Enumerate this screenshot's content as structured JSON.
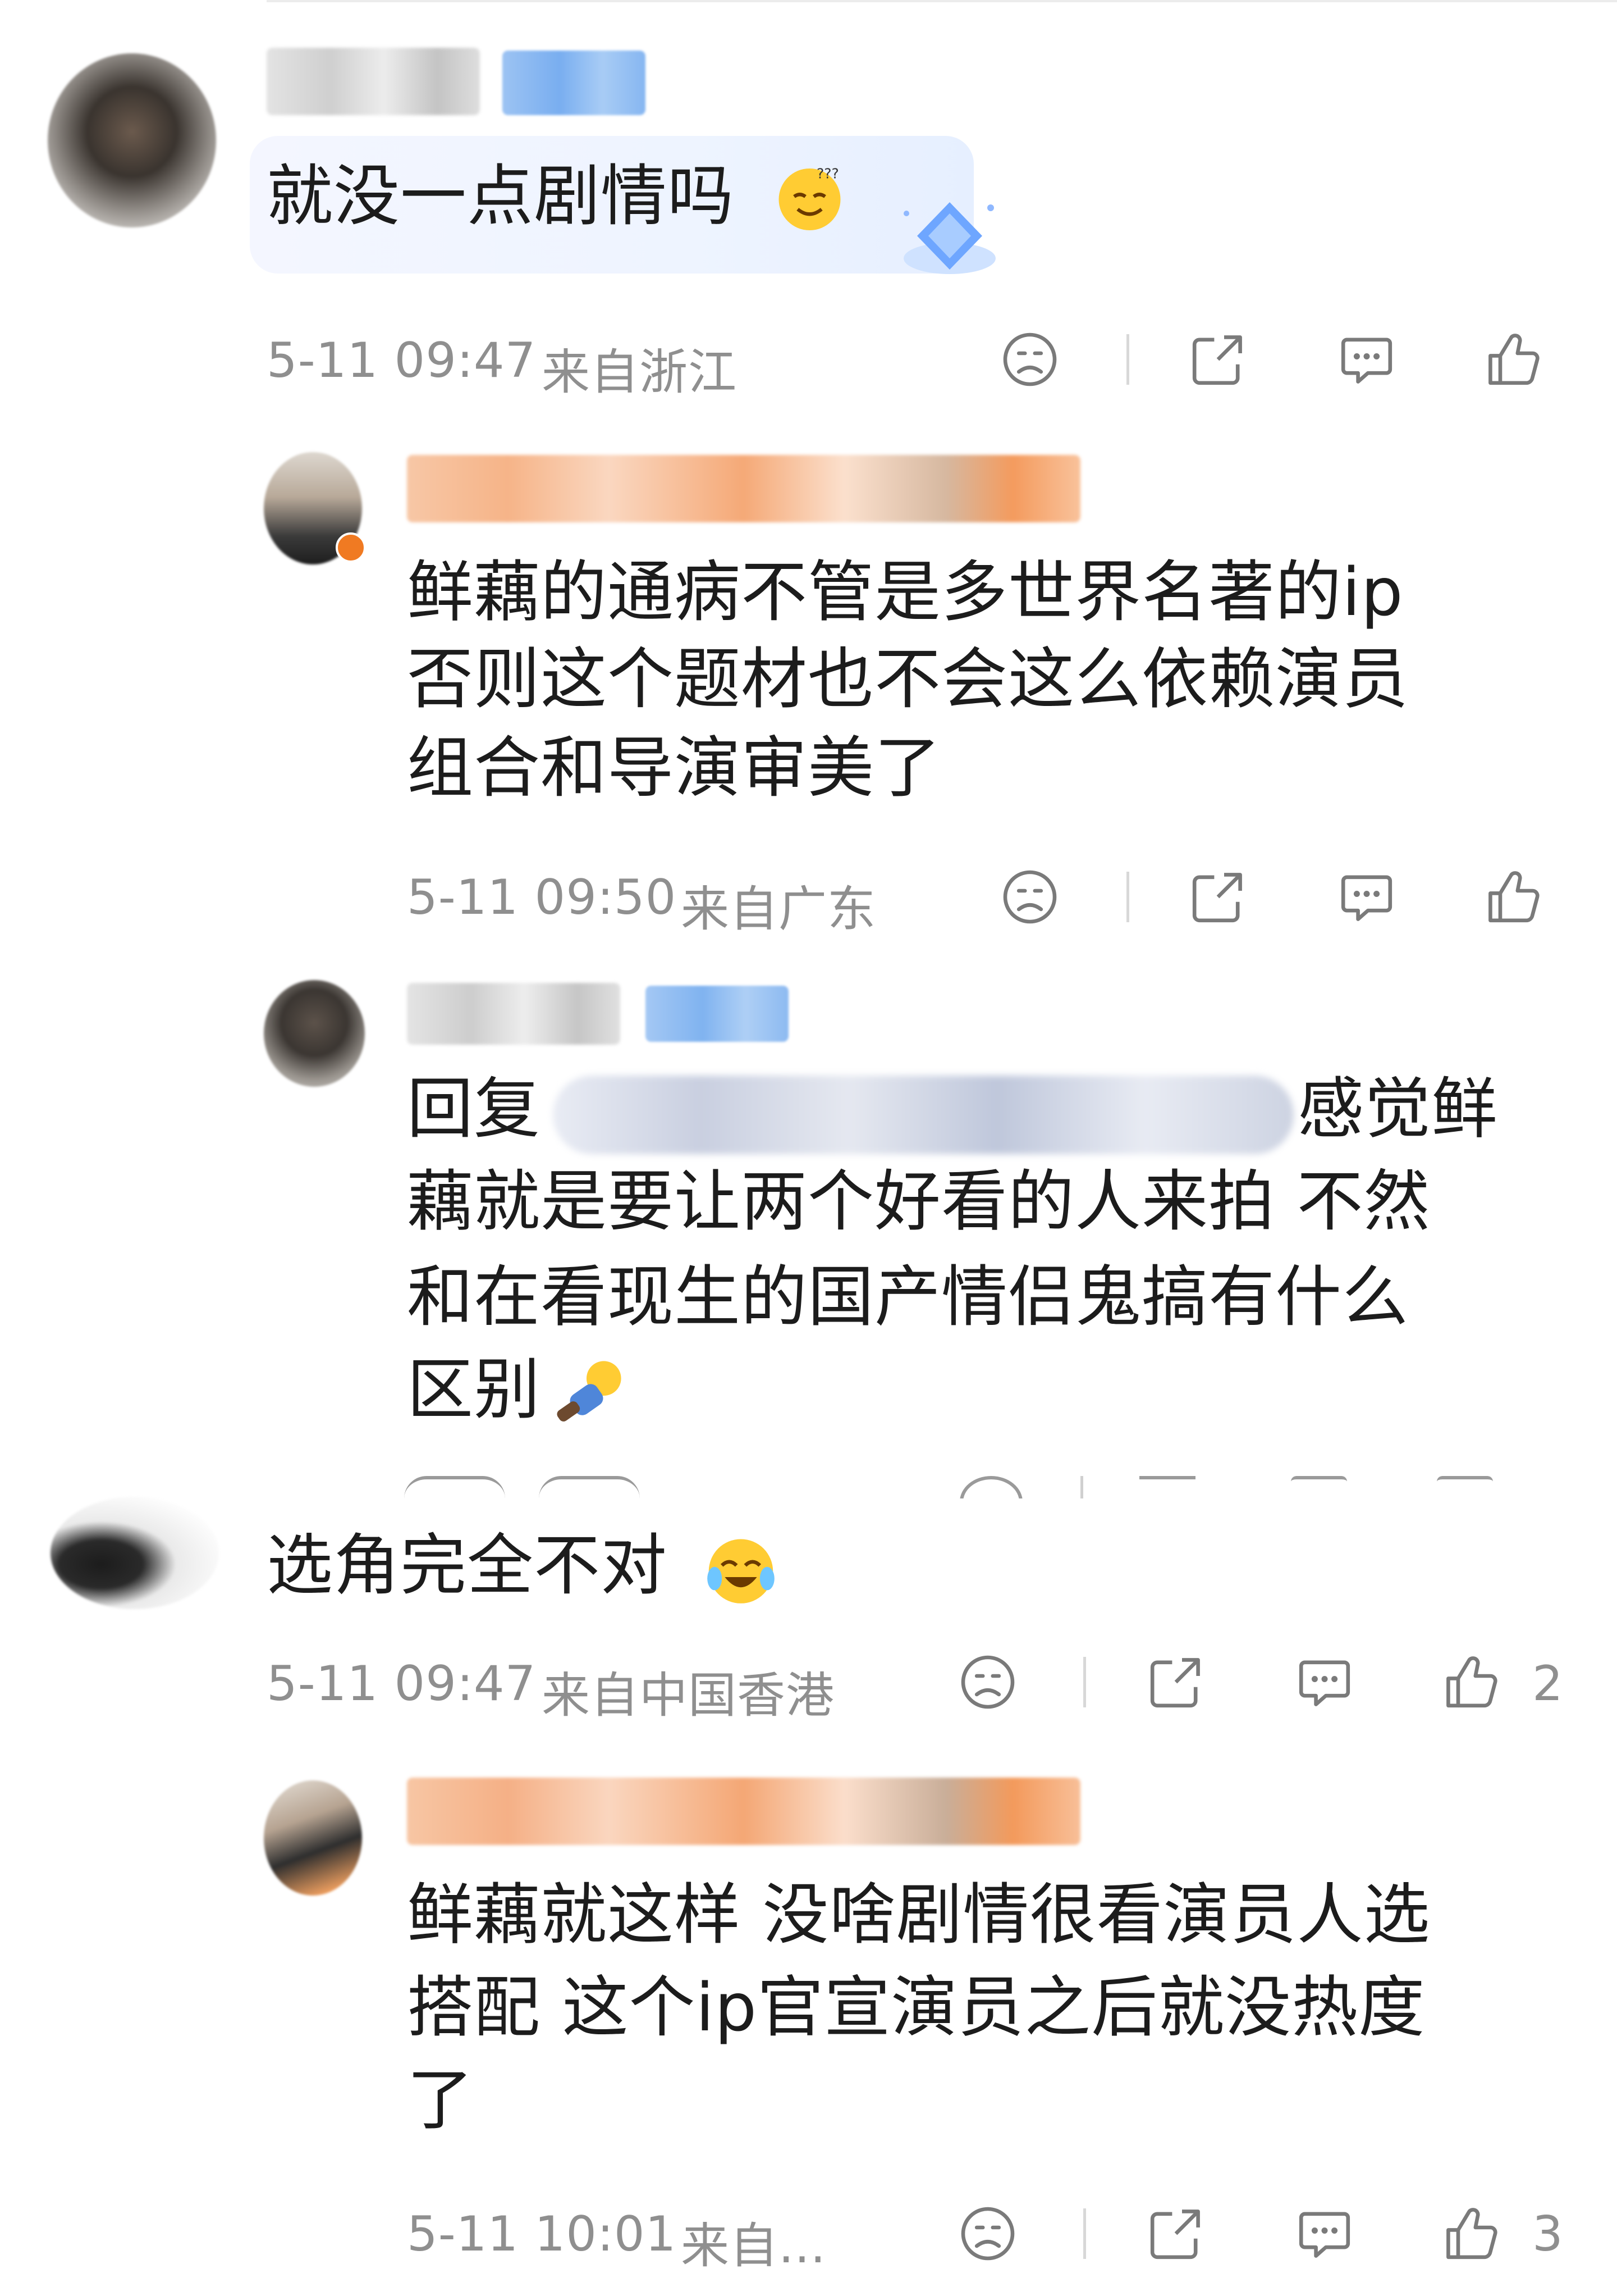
{
  "comments": [
    {
      "text": "就没一点剧情吗",
      "time": "5-11 09:47",
      "location": "来自浙江",
      "likes": ""
    },
    {
      "text_lines": [
        "鲜藕的通病不管是多世界名著的ip",
        "否则这个题材也不会这么依赖演员",
        "组合和导演审美了"
      ],
      "time": "5-11 09:50",
      "location": "来自广东",
      "likes": ""
    },
    {
      "text_lines": [
        "回复",
        "感觉鲜",
        "藕就是要让两个好看的人来拍 不然",
        "和在看现生的国产情侣鬼搞有什么",
        "区别"
      ],
      "time": "",
      "location": "",
      "likes": ""
    },
    {
      "text": "选角完全不对",
      "time": "5-11 09:47",
      "location": "来自中国香港",
      "likes": "2"
    },
    {
      "text_lines": [
        "鲜藕就这样 没啥剧情很看演员人选",
        "搭配 这个ip官宣演员之后就没热度",
        "了"
      ],
      "time": "5-11 10:01",
      "location": "来自...",
      "likes": "3"
    }
  ],
  "icons": [
    "dislike-face-icon",
    "share-icon",
    "comment-icon",
    "like-thumb-icon"
  ],
  "colors": {
    "meta_text": "#8f8f8f",
    "main_text": "#1c1c1c",
    "vip_orange": "#f6a064",
    "name_blue": "#7fb3f0"
  }
}
